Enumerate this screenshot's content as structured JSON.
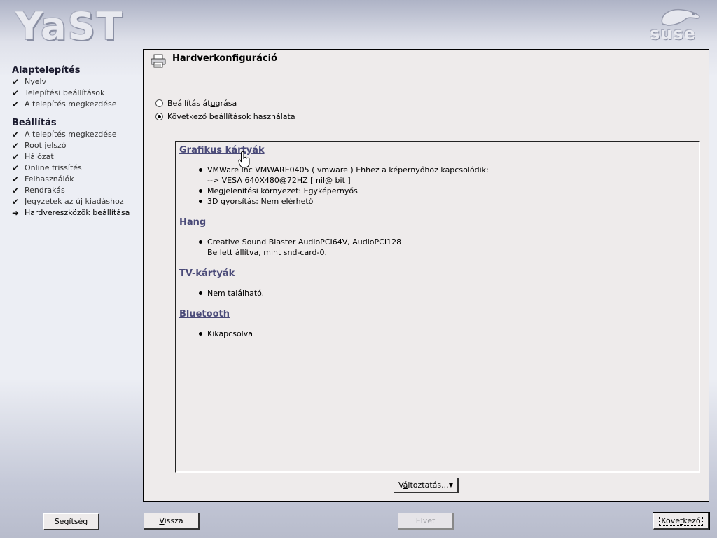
{
  "branding": {
    "app_logo": "YaST",
    "vendor_logo": "suse"
  },
  "sidebar": {
    "groups": [
      {
        "title": "Alaptelepítés",
        "steps": [
          {
            "label": "Nyelv",
            "state": "done"
          },
          {
            "label": "Telepítési beállítások",
            "state": "done"
          },
          {
            "label": "A telepítés megkezdése",
            "state": "done"
          }
        ]
      },
      {
        "title": "Beállítás",
        "steps": [
          {
            "label": "A telepítés megkezdése",
            "state": "done"
          },
          {
            "label": "Root jelszó",
            "state": "done"
          },
          {
            "label": "Hálózat",
            "state": "done"
          },
          {
            "label": "Online frissítés",
            "state": "done"
          },
          {
            "label": "Felhasználók",
            "state": "done"
          },
          {
            "label": "Rendrakás",
            "state": "done"
          },
          {
            "label": "Jegyzetek az új kiadáshoz",
            "state": "done"
          },
          {
            "label": "Hardvereszközök beállítása",
            "state": "current"
          }
        ]
      }
    ]
  },
  "main": {
    "title": "Hardverkonfiguráció",
    "title_icon": "printer-icon",
    "options": {
      "skip": {
        "pre": "Beállítás át",
        "accel": "u",
        "post": "grása",
        "checked": false
      },
      "use": {
        "pre": "Következő beállítások ",
        "accel": "h",
        "post": "asználata",
        "checked": true
      }
    },
    "sections": {
      "graphics": {
        "heading": "Grafikus kártyák",
        "items": [
          "VMWare Inc VMWARE0405 ( vmware ) Ehhez a képernyőhöz kapcsolódik:",
          "--> VESA 640X480@72HZ [ nil@ bit ]",
          "Megjelenítési környezet: Egyképernyős",
          "3D gyorsítás: Nem elérhető"
        ]
      },
      "sound": {
        "heading": "Hang",
        "items": [
          "Creative Sound Blaster AudioPCI64V, AudioPCI128",
          "Be lett állítva, mint snd-card-0."
        ]
      },
      "tv": {
        "heading": "TV-kártyák",
        "items": [
          "Nem található."
        ]
      },
      "bluetooth": {
        "heading": "Bluetooth",
        "items": [
          "Kikapcsolva"
        ]
      }
    },
    "change_button": {
      "pre": "V",
      "accel": "á",
      "post": "ltoztatás...",
      "arrow": "▼"
    }
  },
  "footer": {
    "help": {
      "pre": "Segítség",
      "accel": "",
      "post": ""
    },
    "back": {
      "pre": "",
      "accel": "V",
      "post": "issza"
    },
    "abort": {
      "pre": "Elvet",
      "accel": "",
      "post": "",
      "disabled": true
    },
    "next": {
      "pre": "Köve",
      "accel": "t",
      "post": "kező"
    }
  },
  "colors": {
    "heading_link": "#4a4a78",
    "panel": "#eeebeb"
  }
}
